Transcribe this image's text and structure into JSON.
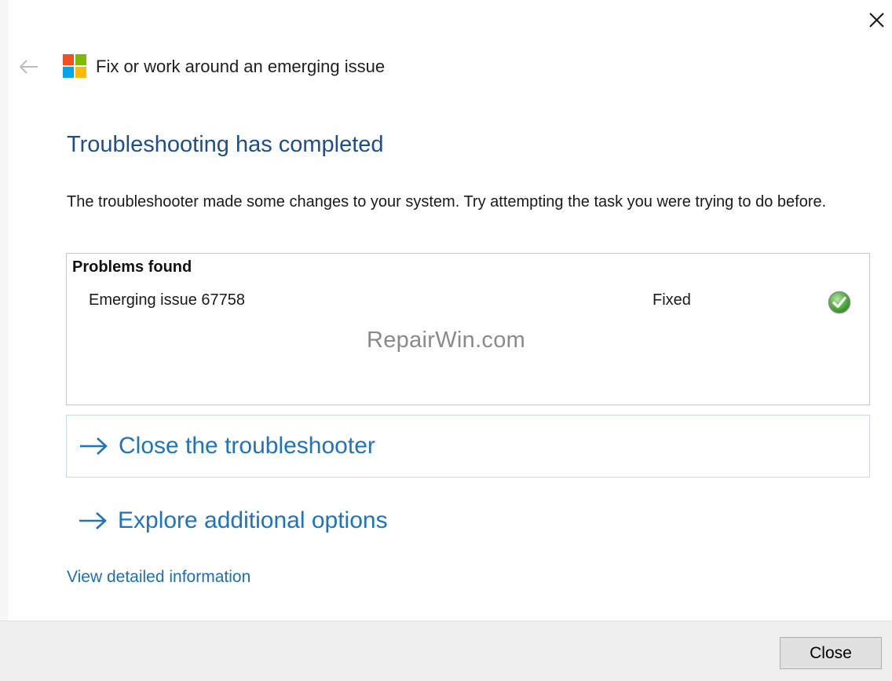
{
  "window": {
    "title": "Fix or work around an emerging issue",
    "close_icon": "close-icon",
    "back_icon": "back-arrow-icon",
    "logo_icon": "windows-logo-icon"
  },
  "content": {
    "heading": "Troubleshooting has completed",
    "description": "The troubleshooter made some changes to your system. Try attempting the task you were trying to do before."
  },
  "problems": {
    "title": "Problems found",
    "items": [
      {
        "name": "Emerging issue 67758",
        "status": "Fixed",
        "status_icon": "check-circle-icon"
      }
    ],
    "watermark": "RepairWin.com"
  },
  "options": [
    {
      "label": "Close the troubleshooter",
      "icon": "arrow-right-icon"
    },
    {
      "label": "Explore additional options",
      "icon": "arrow-right-icon"
    }
  ],
  "detail_link": "View detailed information",
  "footer": {
    "close_label": "Close"
  },
  "colors": {
    "heading": "#1e4e8c",
    "link": "#1e73be",
    "footer_bg": "#efefef",
    "check_green": "#3aa534"
  }
}
